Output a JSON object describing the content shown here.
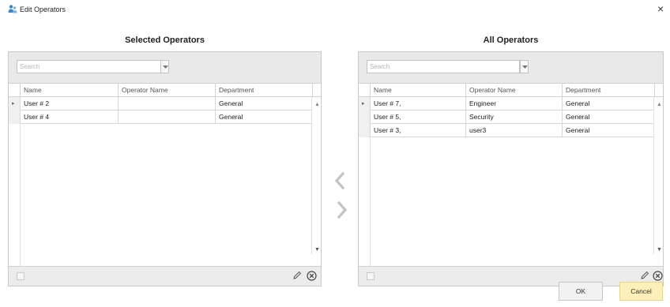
{
  "window": {
    "title": "Edit Operators",
    "close_glyph": "×",
    "icon": "operators-app-icon"
  },
  "selected": {
    "heading": "Selected Operators",
    "search_placeholder": "Search",
    "columns": [
      "Name",
      "Operator Name",
      "Department"
    ],
    "rows": [
      {
        "name": "User # 2",
        "operator_name": "",
        "department": "General",
        "current": true
      },
      {
        "name": "User # 4",
        "operator_name": "",
        "department": "General",
        "current": false
      }
    ]
  },
  "all": {
    "heading": "All Operators",
    "search_placeholder": "Search",
    "columns": [
      "Name",
      "Operator Name",
      "Department"
    ],
    "rows": [
      {
        "name": "User # 7,",
        "operator_name": "Engineer",
        "department": "General",
        "current": true
      },
      {
        "name": "User # 5,",
        "operator_name": "Security",
        "department": "General",
        "current": false
      },
      {
        "name": "User # 3,",
        "operator_name": "user3",
        "department": "General",
        "current": false
      }
    ]
  },
  "transfer": {
    "left_icon": "chevron-left-icon",
    "right_icon": "chevron-right-icon"
  },
  "buttons": {
    "ok": "OK",
    "cancel": "Cancel"
  },
  "colors": {
    "toolbar_bg": "#e9e9e9",
    "cancel_bg": "#fdf0b8",
    "arrow_gray": "#c4c4c4"
  }
}
